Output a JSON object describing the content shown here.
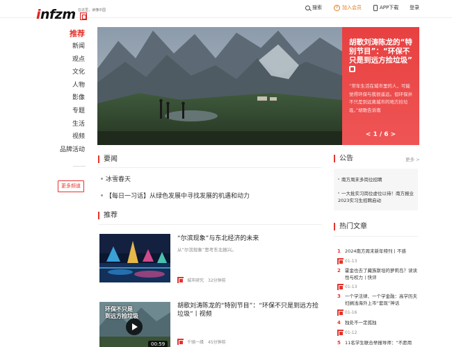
{
  "header": {
    "logo_text": "infzm",
    "logo_slogan": "在这里，读懂中国",
    "search_label": "搜索",
    "vip_icon_text": "V",
    "vip_label": "加入会员",
    "app_label": "APP下载",
    "login_label": "登录"
  },
  "left_nav": {
    "items": [
      "推荐",
      "新闻",
      "观点",
      "文化",
      "人物",
      "影像",
      "专题",
      "生活",
      "视频",
      "品牌活动"
    ],
    "more_channels": "更多频道"
  },
  "hero": {
    "title": "胡歌刘涛陈龙的“特别节目”：“环保不只是到远方捡垃圾”",
    "description": "“常年生活在城市里的人，可能觉得环保与我很遥远。但环保并不只是到远离城市的地方捡垃圾，”胡歌告诉南",
    "pager": "< 1 / 6 >"
  },
  "news": {
    "heading": "要闻",
    "items": [
      "冰雪春天",
      "【每日一习话】从绿色发展中寻找发展的机遇和动力"
    ]
  },
  "recommend": {
    "heading": "推荐",
    "cards": [
      {
        "title": "“尔滨现象”与东北经济的未来",
        "subtitle": "从“尔滨现象”思考东北振兴。",
        "author": "城市研究",
        "time": "32分钟前"
      },
      {
        "title": "胡歌刘涛陈龙的“特别节目”：“环保不只是到远方捡垃圾”丨视频",
        "author": "千骑一缘",
        "time": "45分钟前",
        "video_caption": "环保不只是\n到远方捡垃圾",
        "duration": "00:59"
      }
    ]
  },
  "announcements": {
    "heading": "公告",
    "more": "更多 >",
    "items": [
      "南方周末多岗位招聘",
      "一大批实习岗位虚位以待！南方报业2023实习生招聘启动"
    ]
  },
  "hot": {
    "heading": "热门文章",
    "items": [
      {
        "rank": "1",
        "title": "2024南方周末新年特刊丨不惑",
        "date": "01-13"
      },
      {
        "rank": "2",
        "title": "霍金也去了藏族斯坦的萝莉岛？读读性与权力丨快评",
        "date": "01-13"
      },
      {
        "rank": "3",
        "title": "一个学法律、一个学金融：高学历夫妇搁浅海外上市“套现”神话",
        "date": "01-16"
      },
      {
        "rank": "4",
        "title": "独处不一定孤独",
        "date": "01-12"
      },
      {
        "rank": "5",
        "title": "11名学生联合举报导师：“不愿用"
      }
    ]
  },
  "colors": {
    "accent": "#e5332c",
    "vip": "#e47a1a",
    "hero_panel": "#e84040"
  }
}
